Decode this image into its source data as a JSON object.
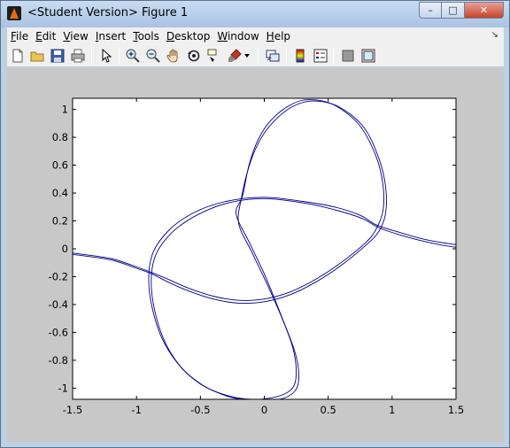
{
  "window": {
    "title": "<Student Version> Figure 1",
    "caption_buttons": {
      "minimize": "–",
      "maximize": "□",
      "close": "✕"
    }
  },
  "menu": [
    "File",
    "Edit",
    "View",
    "Insert",
    "Tools",
    "Desktop",
    "Window",
    "Help"
  ],
  "toolbar": {
    "icons": [
      "new-figure-icon",
      "open-file-icon",
      "save-icon",
      "print-icon",
      "edit-plot-icon",
      "zoom-in-icon",
      "zoom-out-icon",
      "pan-icon",
      "rotate-3d-icon",
      "data-cursor-icon",
      "brush-icon",
      "brush-dropdown-icon",
      "link-plot-icon",
      "insert-colorbar-icon",
      "insert-legend-icon",
      "hide-plot-tools-icon",
      "show-plot-tools-icon"
    ]
  },
  "chart_data": {
    "type": "line",
    "title": "",
    "xlabel": "",
    "ylabel": "",
    "xlim": [
      -1.5,
      1.5
    ],
    "ylim": [
      -1.08,
      1.08
    ],
    "xticks": [
      "-1.5",
      "-1",
      "-0.5",
      "0",
      "0.5",
      "1",
      "1.5"
    ],
    "yticks": [
      "-1",
      "-0.8",
      "-0.6",
      "-0.4",
      "-0.2",
      "0",
      "0.2",
      "0.4",
      "0.6",
      "0.8",
      "1"
    ],
    "grid": false,
    "line_color": "#00008b",
    "series": [
      {
        "x": [
          -1.5,
          -1.2,
          -1.0,
          -0.88,
          -0.75,
          -0.6,
          -0.4,
          -0.2,
          0.0,
          0.2,
          0.4,
          0.6,
          0.8,
          0.88,
          0.93,
          0.93,
          0.88,
          0.75,
          0.55,
          0.35,
          0.2,
          0.05,
          -0.05,
          -0.12,
          -0.17,
          -0.22,
          -0.12,
          0.0,
          0.12,
          0.22,
          0.25,
          0.22,
          0.1,
          -0.1,
          -0.3,
          -0.5,
          -0.68,
          -0.82,
          -0.9,
          -0.88,
          -0.75,
          -0.55,
          -0.3,
          0.0,
          0.3,
          0.55,
          0.75,
          0.88,
          1.05,
          1.2,
          1.35,
          1.5
        ],
        "y": [
          -0.03,
          -0.07,
          -0.13,
          -0.17,
          -0.22,
          -0.28,
          -0.34,
          -0.37,
          -0.36,
          -0.31,
          -0.22,
          -0.1,
          0.05,
          0.15,
          0.28,
          0.45,
          0.65,
          0.88,
          1.03,
          1.07,
          1.03,
          0.92,
          0.78,
          0.6,
          0.38,
          0.25,
          0.05,
          -0.18,
          -0.45,
          -0.7,
          -0.88,
          -1.0,
          -1.06,
          -1.08,
          -1.05,
          -0.97,
          -0.82,
          -0.6,
          -0.3,
          -0.05,
          0.13,
          0.26,
          0.34,
          0.37,
          0.34,
          0.3,
          0.24,
          0.17,
          0.12,
          0.08,
          0.05,
          0.03
        ]
      },
      {
        "x": [
          -1.5,
          -1.2,
          -1.0,
          -0.88,
          -0.75,
          -0.6,
          -0.4,
          -0.2,
          0.0,
          0.2,
          0.4,
          0.6,
          0.8,
          0.9,
          0.95,
          0.95,
          0.9,
          0.78,
          0.58,
          0.38,
          0.22,
          0.07,
          -0.04,
          -0.12,
          -0.18,
          -0.2,
          -0.1,
          0.02,
          0.14,
          0.24,
          0.27,
          0.24,
          0.12,
          -0.08,
          -0.28,
          -0.48,
          -0.66,
          -0.8,
          -0.88,
          -0.86,
          -0.73,
          -0.53,
          -0.28,
          0.0,
          0.3,
          0.55,
          0.76,
          0.9,
          1.06,
          1.22,
          1.37,
          1.5
        ],
        "y": [
          -0.04,
          -0.08,
          -0.14,
          -0.18,
          -0.24,
          -0.3,
          -0.36,
          -0.39,
          -0.38,
          -0.33,
          -0.24,
          -0.12,
          0.03,
          0.13,
          0.26,
          0.44,
          0.64,
          0.87,
          1.02,
          1.06,
          1.02,
          0.91,
          0.77,
          0.59,
          0.36,
          0.18,
          -0.02,
          -0.25,
          -0.5,
          -0.74,
          -0.91,
          -1.02,
          -1.08,
          -1.09,
          -1.06,
          -0.98,
          -0.84,
          -0.62,
          -0.32,
          -0.07,
          0.11,
          0.24,
          0.33,
          0.36,
          0.33,
          0.28,
          0.22,
          0.15,
          0.1,
          0.06,
          0.03,
          0.01
        ]
      }
    ]
  }
}
